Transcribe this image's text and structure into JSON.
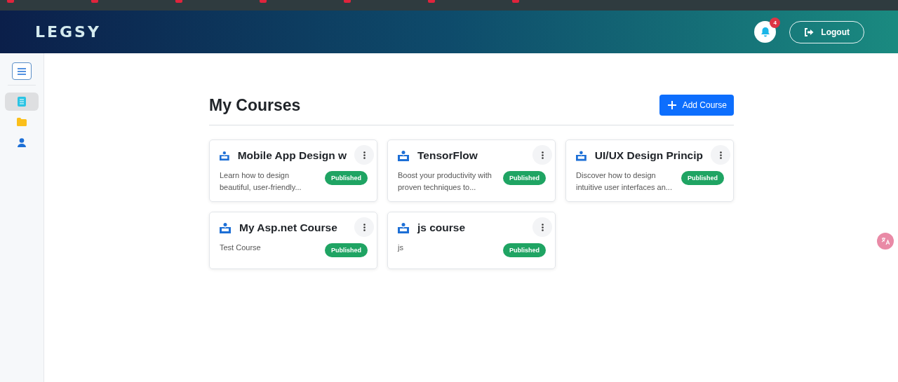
{
  "header": {
    "logo": "LEGSY",
    "notifications": {
      "count": "4"
    },
    "logout": "Logout"
  },
  "sidebar": {
    "items": [
      {
        "kind": "book",
        "selected": true
      },
      {
        "kind": "folder",
        "selected": false
      },
      {
        "kind": "user",
        "selected": false
      }
    ]
  },
  "page": {
    "title": "My Courses",
    "add_button": "Add Course"
  },
  "courses": [
    {
      "title": "Mobile App Design w",
      "description": "Learn how to design beautiful, user-friendly...",
      "status": "Published",
      "kind": "published"
    },
    {
      "title": "TensorFlow",
      "description": "Boost your productivity with proven techniques to...",
      "status": "Published",
      "kind": "published"
    },
    {
      "title": "UI/UX Design Princip",
      "description": "Discover how to design intuitive user interfaces an...",
      "status": "Published",
      "kind": "published"
    },
    {
      "title": "My Asp.net Course",
      "description": "Test Course",
      "status": "Published",
      "kind": "published"
    },
    {
      "title": "js course",
      "description": "js",
      "status": "Published",
      "kind": "published"
    }
  ]
}
